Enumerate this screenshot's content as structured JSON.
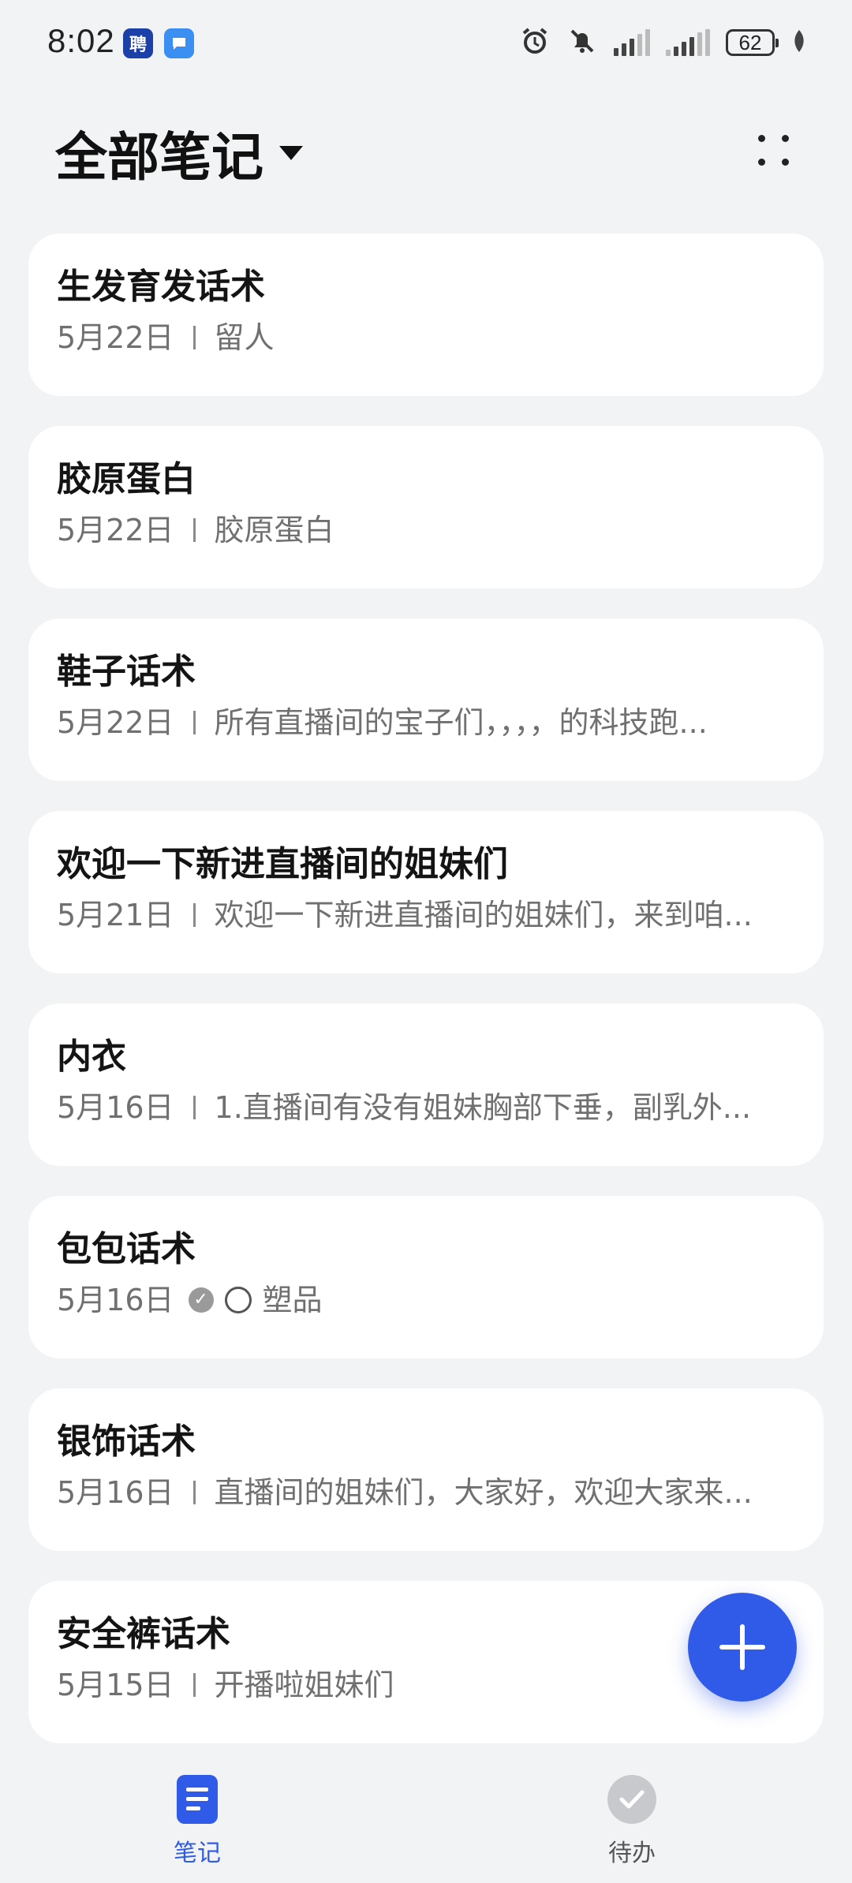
{
  "status_bar": {
    "time": "8:02",
    "app_badge_1": "聘",
    "battery": "62"
  },
  "header": {
    "title": "全部笔记"
  },
  "notes": [
    {
      "title": "生发育发话术",
      "date": "5月22日",
      "snippet": "留人"
    },
    {
      "title": "胶原蛋白",
      "date": "5月22日",
      "snippet": "胶原蛋白"
    },
    {
      "title": "鞋子话术",
      "date": "5月22日",
      "snippet": "所有直播间的宝子们，，，，的科技跑..."
    },
    {
      "title": "欢迎一下新进直播间的姐妹们",
      "date": "5月21日",
      "snippet": "欢迎一下新进直播间的姐妹们，来到咱..."
    },
    {
      "title": "内衣",
      "date": "5月16日",
      "snippet": "1.直播间有没有姐妹胸部下垂，副乳外..."
    },
    {
      "title": "包包话术",
      "date": "5月16日",
      "snippet": "塑品"
    },
    {
      "title": "银饰话术",
      "date": "5月16日",
      "snippet": "直播间的姐妹们，大家好，欢迎大家来..."
    },
    {
      "title": "安全裤话术",
      "date": "5月15日",
      "snippet": "开播啦姐妹们"
    }
  ],
  "bottom_nav": {
    "notes_label": "笔记",
    "todo_label": "待办"
  },
  "colors": {
    "accent": "#2f5be8",
    "background": "#f1f3f5",
    "card": "#ffffff"
  }
}
